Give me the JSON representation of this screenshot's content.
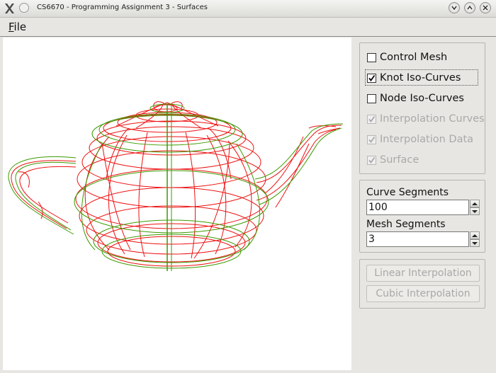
{
  "window": {
    "title": "CS6670 - Programming Assignment 3 - Surfaces"
  },
  "menubar": {
    "file_label_underlined": "F",
    "file_label_rest": "ile"
  },
  "options": {
    "control_mesh": {
      "label": "Control Mesh",
      "checked": false,
      "enabled": true
    },
    "knot_iso_curves": {
      "label": "Knot Iso-Curves",
      "checked": true,
      "enabled": true
    },
    "node_iso_curves": {
      "label": "Node Iso-Curves",
      "checked": false,
      "enabled": true
    },
    "interpolation_curves": {
      "label": "Interpolation Curves",
      "checked": true,
      "enabled": false
    },
    "interpolation_data": {
      "label": "Interpolation Data",
      "checked": true,
      "enabled": false
    },
    "surface": {
      "label": "Surface",
      "checked": true,
      "enabled": false
    }
  },
  "segments": {
    "curve_label": "Curve Segments",
    "curve_value": "100",
    "mesh_label": "Mesh Segments",
    "mesh_value": "3"
  },
  "buttons": {
    "linear": "Linear Interpolation",
    "cubic": "Cubic Interpolation"
  },
  "colors": {
    "knot_curves": "#ee1111",
    "boundary_curves": "#3c9a00"
  },
  "icons": {
    "app": "x-app-icon",
    "system_menu": "circle-menu-icon",
    "minimize": "minimize-icon",
    "maximize": "maximize-icon",
    "close": "close-icon"
  }
}
